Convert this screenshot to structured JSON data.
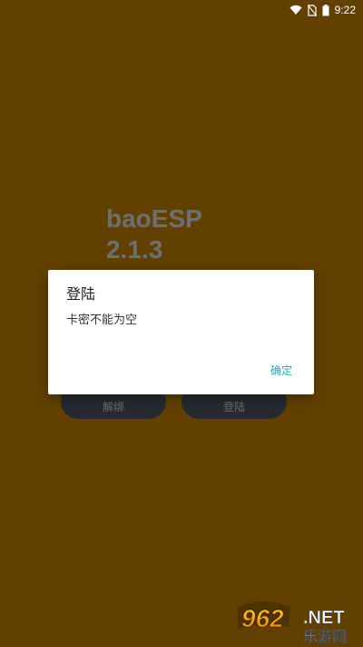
{
  "status_bar": {
    "time": "9:22",
    "icons": [
      "wifi-icon",
      "no-sim-icon",
      "battery-icon"
    ]
  },
  "app": {
    "name": "baoESP",
    "version": "2.1.3",
    "background_color": "#614002"
  },
  "buttons": {
    "unbind_label": "解绑",
    "login_label": "登陆"
  },
  "dialog": {
    "title": "登陆",
    "message": "卡密不能为空",
    "confirm_label": "确定",
    "accent_color": "#1fa9b8"
  },
  "watermark": {
    "brand_number": "962",
    "brand_suffix": ".NET",
    "brand_cn": "乐游网"
  }
}
